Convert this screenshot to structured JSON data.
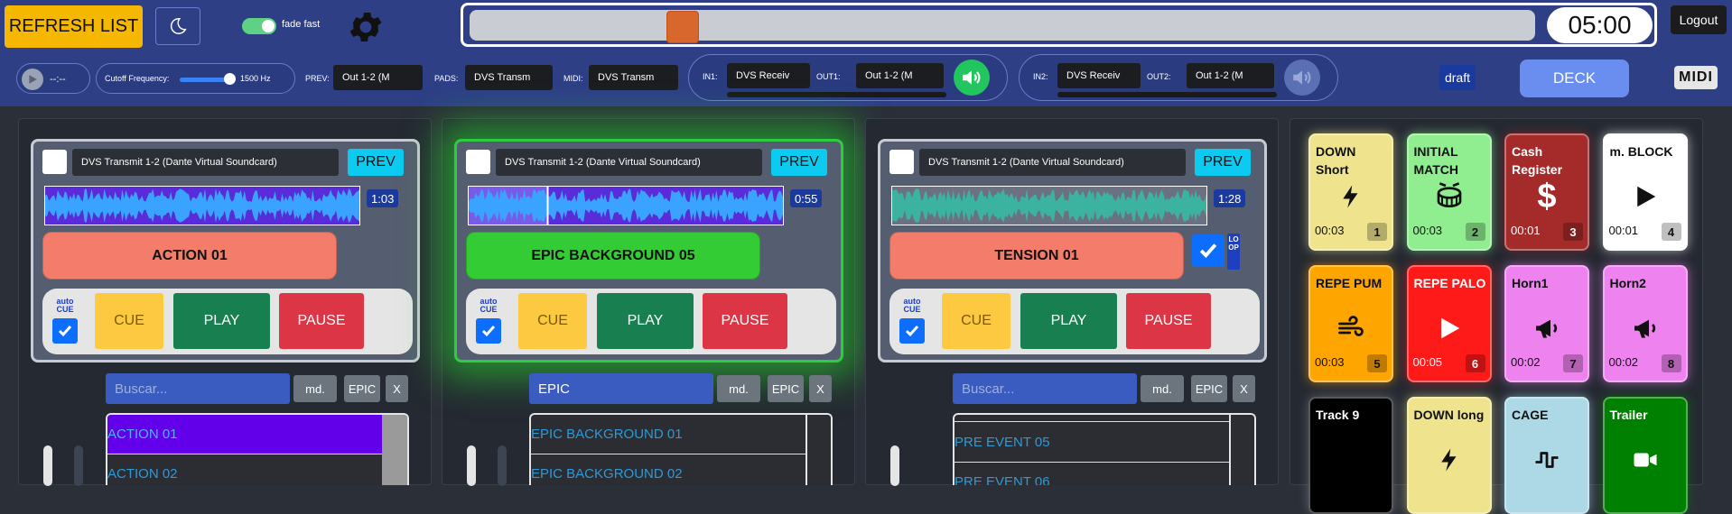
{
  "topbar": {
    "refresh_label": "REFRESH LIST",
    "fade_label": "fade fast",
    "timer": "05:00",
    "logout_label": "Logout",
    "progress_fraction": 0.2
  },
  "controls": {
    "play_time": "--:--",
    "cutoff_label": "Cutoff Frequency:",
    "cutoff_value": "1500 Hz",
    "prev_label": "PREV:",
    "prev_value": "Out 1-2 (M",
    "pads_label": "PADS:",
    "pads_value": "DVS Transm",
    "midi_label": "MIDI:",
    "midi_value": "DVS Transm",
    "in1_label": "IN1:",
    "in1_value": "DVS Receiv",
    "out1_label": "OUT1:",
    "out1_value": "Out 1-2 (M",
    "in2_label": "IN2:",
    "in2_value": "DVS Receiv",
    "out2_label": "OUT2:",
    "out2_value": "Out 1-2 (M",
    "draft_label": "draft",
    "deck_label": "DECK",
    "midi_badge": "MIDI"
  },
  "decks": [
    {
      "device": "DVS Transmit 1-2 (Dante Virtual Soundcard)",
      "prev": "PREV",
      "duration": "1:03",
      "track": "ACTION 01",
      "auto_cue": "auto CUE",
      "cue": "CUE",
      "play": "PLAY",
      "pause": "PAUSE",
      "search_placeholder": "Buscar...",
      "search_value": "",
      "md": "md.",
      "epic": "EPIC",
      "x": "X",
      "items": [
        "ACTION 01",
        "ACTION 02"
      ]
    },
    {
      "device": "DVS Transmit 1-2 (Dante Virtual Soundcard)",
      "prev": "PREV",
      "duration": "0:55",
      "track": "EPIC BACKGROUND 05",
      "auto_cue": "auto CUE",
      "cue": "CUE",
      "play": "PLAY",
      "pause": "PAUSE",
      "search_placeholder": "Buscar...",
      "search_value": "EPIC",
      "md": "md.",
      "epic": "EPIC",
      "x": "X",
      "items": [
        "EPIC BACKGROUND 01",
        "EPIC BACKGROUND 02"
      ]
    },
    {
      "device": "DVS Transmit 1-2 (Dante Virtual Soundcard)",
      "prev": "PREV",
      "duration": "1:28",
      "track": "TENSION 01",
      "auto_cue": "auto CUE",
      "loop": "LOOP",
      "cue": "CUE",
      "play": "PLAY",
      "pause": "PAUSE",
      "search_placeholder": "Buscar...",
      "search_value": "",
      "md": "md.",
      "epic": "EPIC",
      "x": "X",
      "items": [
        "PRE EVENT 05",
        "PRE EVENT 06"
      ]
    }
  ],
  "pads": [
    {
      "title": "DOWN Short",
      "time": "00:03",
      "num": "1",
      "icon": "bolt-icon",
      "bg": "#efe48d",
      "fg": "#111"
    },
    {
      "title": "INITIAL MATCH",
      "time": "00:03",
      "num": "2",
      "icon": "drum-icon",
      "bg": "#90ee90",
      "fg": "#111"
    },
    {
      "title": "Cash Register",
      "time": "00:01",
      "num": "3",
      "icon": "dollar-icon",
      "bg": "#a52a2a",
      "fg": "#fff"
    },
    {
      "title": "m. BLOCK",
      "time": "00:01",
      "num": "4",
      "icon": "play-icon",
      "bg": "#ffffff",
      "fg": "#111"
    },
    {
      "title": "REPE PUM",
      "time": "00:03",
      "num": "5",
      "icon": "wind-icon",
      "bg": "#ffa500",
      "fg": "#111"
    },
    {
      "title": "REPE PALO",
      "time": "00:05",
      "num": "6",
      "icon": "play-icon",
      "bg": "#ff1a1a",
      "fg": "#fff"
    },
    {
      "title": "Horn1",
      "time": "00:02",
      "num": "7",
      "icon": "megaphone-icon",
      "bg": "#ee82ee",
      "fg": "#111"
    },
    {
      "title": "Horn2",
      "time": "00:02",
      "num": "8",
      "icon": "megaphone-icon",
      "bg": "#ee82ee",
      "fg": "#111"
    },
    {
      "title": "Track 9",
      "time": "",
      "num": "",
      "icon": "",
      "bg": "#000000",
      "fg": "#fff"
    },
    {
      "title": "DOWN long",
      "time": "",
      "num": "",
      "icon": "bolt-icon",
      "bg": "#efe48d",
      "fg": "#111"
    },
    {
      "title": "CAGE",
      "time": "",
      "num": "",
      "icon": "square-wave-icon",
      "bg": "#add8e6",
      "fg": "#111"
    },
    {
      "title": "Trailer",
      "time": "",
      "num": "",
      "icon": "video-icon",
      "bg": "#008000",
      "fg": "#fff"
    }
  ]
}
